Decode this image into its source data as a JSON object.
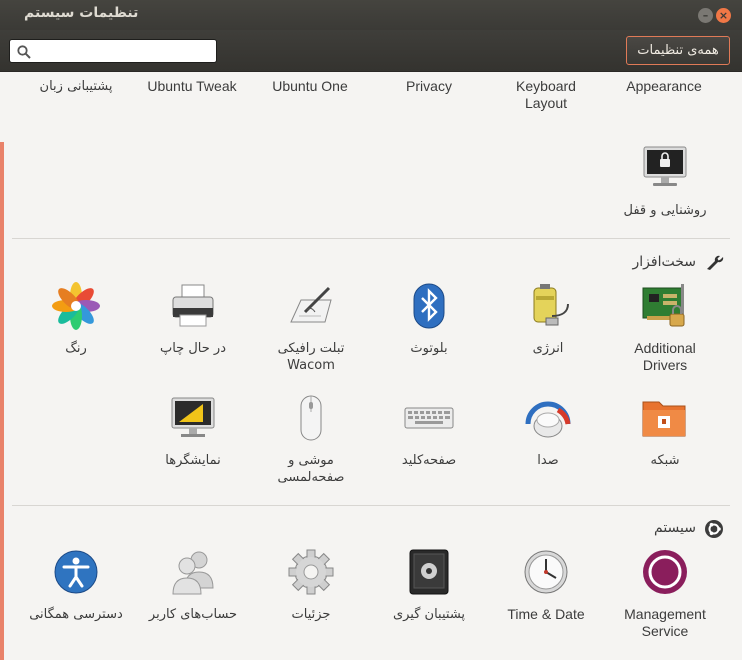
{
  "window": {
    "title": "تنظیمات سیستم",
    "minimize_glyph": "–",
    "close_glyph": "×"
  },
  "toolbar": {
    "search_placeholder": "",
    "all_settings_label": "همه‌ی تنظیمات"
  },
  "personal_row": [
    {
      "label": "Appearance",
      "icon": "appearance-icon"
    },
    {
      "label": "Keyboard Layout",
      "icon": "keyboard-layout-icon"
    },
    {
      "label": "Privacy",
      "icon": "privacy-icon"
    },
    {
      "label": "Ubuntu One",
      "icon": "ubuntu-one-icon"
    },
    {
      "label": "Ubuntu Tweak",
      "icon": "ubuntu-tweak-icon"
    },
    {
      "label": "پشتیبانی زبان",
      "icon": "language-support-icon"
    }
  ],
  "personal_row2": [
    {
      "label": "روشنایی و قفل",
      "icon": "brightness-lock-icon"
    }
  ],
  "hardware": {
    "title": "سخت‌افزار",
    "icon": "wrench-icon",
    "row1": [
      {
        "label": "Additional Drivers",
        "icon": "additional-drivers-icon"
      },
      {
        "label": "انرژی",
        "icon": "power-icon"
      },
      {
        "label": "بلوتوث",
        "icon": "bluetooth-icon"
      },
      {
        "label": "تبلت رافیکی Wacom",
        "icon": "wacom-tablet-icon"
      },
      {
        "label": "در حال چاپ",
        "icon": "printer-icon"
      },
      {
        "label": "رنگ",
        "icon": "color-icon"
      }
    ],
    "row2": [
      {
        "label": "شبکه",
        "icon": "network-icon"
      },
      {
        "label": "صدا",
        "icon": "sound-icon"
      },
      {
        "label": "صفحه‌کلید",
        "icon": "keyboard-icon"
      },
      {
        "label": "موشی و صفحه‌لمسی",
        "icon": "mouse-touchpad-icon"
      },
      {
        "label": "نمایشگرها",
        "icon": "displays-icon"
      }
    ]
  },
  "system": {
    "title": "سیستم",
    "icon": "ubuntu-logo-icon",
    "row1": [
      {
        "label": "Management Service",
        "icon": "management-service-icon"
      },
      {
        "label": "Time & Date",
        "icon": "time-date-icon"
      },
      {
        "label": "پشتیبان گیری",
        "icon": "backup-icon"
      },
      {
        "label": "جزئیات",
        "icon": "details-icon"
      },
      {
        "label": "حساب‌های کاربر",
        "icon": "user-accounts-icon"
      },
      {
        "label": "دسترسی همگانی",
        "icon": "universal-access-icon"
      }
    ]
  },
  "colors": {
    "accent": "#e9826a",
    "titlebar": "#3c3b37",
    "content_bg": "#f5f4f2"
  }
}
